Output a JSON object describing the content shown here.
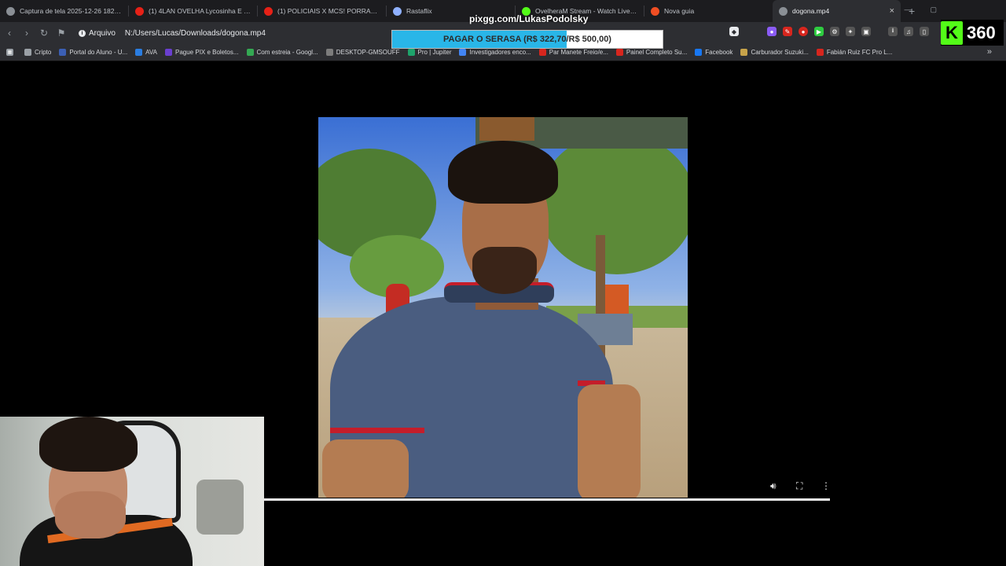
{
  "tabs": [
    {
      "title": "Captura de tela 2025-12-26 182933",
      "icon": "globe-icon",
      "color": "#8a8f95"
    },
    {
      "title": "(1) 4LAN OVELHA Lycosinha E KIKIM",
      "icon": "youtube-icon",
      "color": "#e62117"
    },
    {
      "title": "(1) POLICIAIS X MCS! PORRADA COM",
      "icon": "youtube-icon",
      "color": "#e62117"
    },
    {
      "title": "Rastaflix",
      "icon": "rastaflix-icon",
      "color": "#8fb0ff"
    },
    {
      "title": "OvelheraM Stream - Watch Live on K",
      "icon": "kick-icon",
      "color": "#53fc18"
    },
    {
      "title": "Nova guia",
      "icon": "brave-icon",
      "color": "#f04e23"
    },
    {
      "title": "dogona.mp4",
      "icon": "globe-icon",
      "color": "#8a8f95",
      "active": true
    }
  ],
  "address": {
    "chip": "Arquivo",
    "url": "N:/Users/Lucas/Downloads/dogona.mp4"
  },
  "bookmarks": [
    {
      "label": "Cripto",
      "color": "#9aa0a6"
    },
    {
      "label": "Portal do Aluno - U...",
      "color": "#3b5fb4"
    },
    {
      "label": "AVA",
      "color": "#2a7de1"
    },
    {
      "label": "Pague PIX e Boletos...",
      "color": "#6a3fd0"
    },
    {
      "label": "Com estreia - Googl...",
      "color": "#34a853"
    },
    {
      "label": "DESKTOP-GMSOUFF",
      "color": "#7c7c7c"
    },
    {
      "label": "Pro | Jupiter",
      "color": "#1ea36b"
    },
    {
      "label": "Investigadores enco...",
      "color": "#4285f4"
    },
    {
      "label": "Par Manete Freio/e...",
      "color": "#d7261e"
    },
    {
      "label": "Painel Completo Su...",
      "color": "#d7261e"
    },
    {
      "label": "Facebook",
      "color": "#1877f2"
    },
    {
      "label": "Carburador Suzuki...",
      "color": "#c7a34a"
    },
    {
      "label": "Fabián Ruiz FC Pro L...",
      "color": "#d7261e"
    }
  ],
  "overlay": {
    "pix_title": "pixgg.com/LukasPodolsky",
    "goal_text": "PAGAR O SERASA (R$ 322,70/R$ 500,00)",
    "goal_fraction": 0.6454,
    "viewer_count": "360",
    "brand_color": "#53fc18"
  },
  "video": {
    "progress_fraction": 1.0
  }
}
